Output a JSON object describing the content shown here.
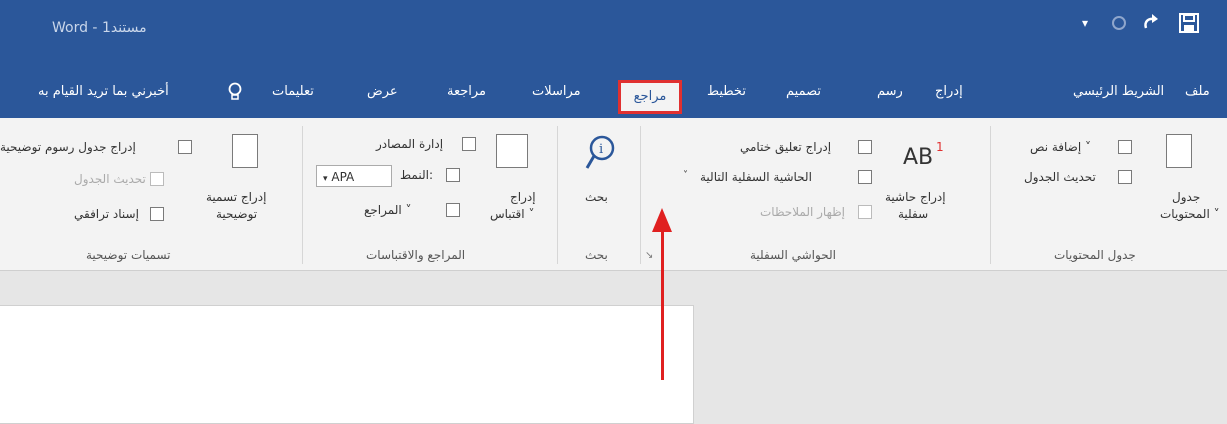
{
  "title": "Word - مستند1",
  "quick_access": {
    "save_icon": "save-icon",
    "redo_icon": "redo-icon",
    "undo_icon": "undo-icon",
    "customize_icon": "customize-icon"
  },
  "tabs": [
    "ملف",
    "الشريط الرئيسي",
    "إدراج",
    "رسم",
    "تصميم",
    "تخطيط",
    "مراجع",
    "مراسلات",
    "مراجعة",
    "عرض",
    "تعليمات"
  ],
  "active_tab": "مراجع",
  "tell_me": "أخبرني بما تريد القيام به",
  "ribbon": {
    "toc": {
      "group": "جدول المحتويات",
      "big_label_1": "جدول",
      "big_label_2": "المحتويات ˅",
      "add_text": "إضافة نص ˅",
      "update_table": "تحديث الجدول"
    },
    "footnotes": {
      "group": "الحواشي السفلية",
      "big_label_1": "إدراج حاشية",
      "big_label_2": "سفلية",
      "ab": "AB",
      "sup": "1",
      "insert_endnote": "إدراج تعليق ختامي",
      "next_footnote": "الحاشية السفلية التالية",
      "show_notes": "إظهار الملاحظات",
      "dropdown": "˅",
      "launcher": "↘"
    },
    "research": {
      "group": "بحث",
      "search_label": "بحث"
    },
    "citations": {
      "group": "المراجع والاقتباسات",
      "insert_1": "إدراج",
      "insert_2": "اقتباس ˅",
      "manage_sources": "إدارة المصادر",
      "style_label": "النمط:",
      "style_value": "APA",
      "style_arrow": "▾",
      "bibliography": "المراجع ˅"
    },
    "captions": {
      "group": "تسميات توضيحية",
      "insert_caption_1": "إدراج تسمية",
      "insert_caption_2": "توضيحية",
      "insert_table_of_figures": "إدراج جدول رسوم توضيحية",
      "update_table": "تحديث الجدول",
      "cross_reference": "إسناد ترافقي"
    }
  },
  "colors": {
    "word_blue": "#2b579a",
    "highlight_red": "#e03030"
  }
}
